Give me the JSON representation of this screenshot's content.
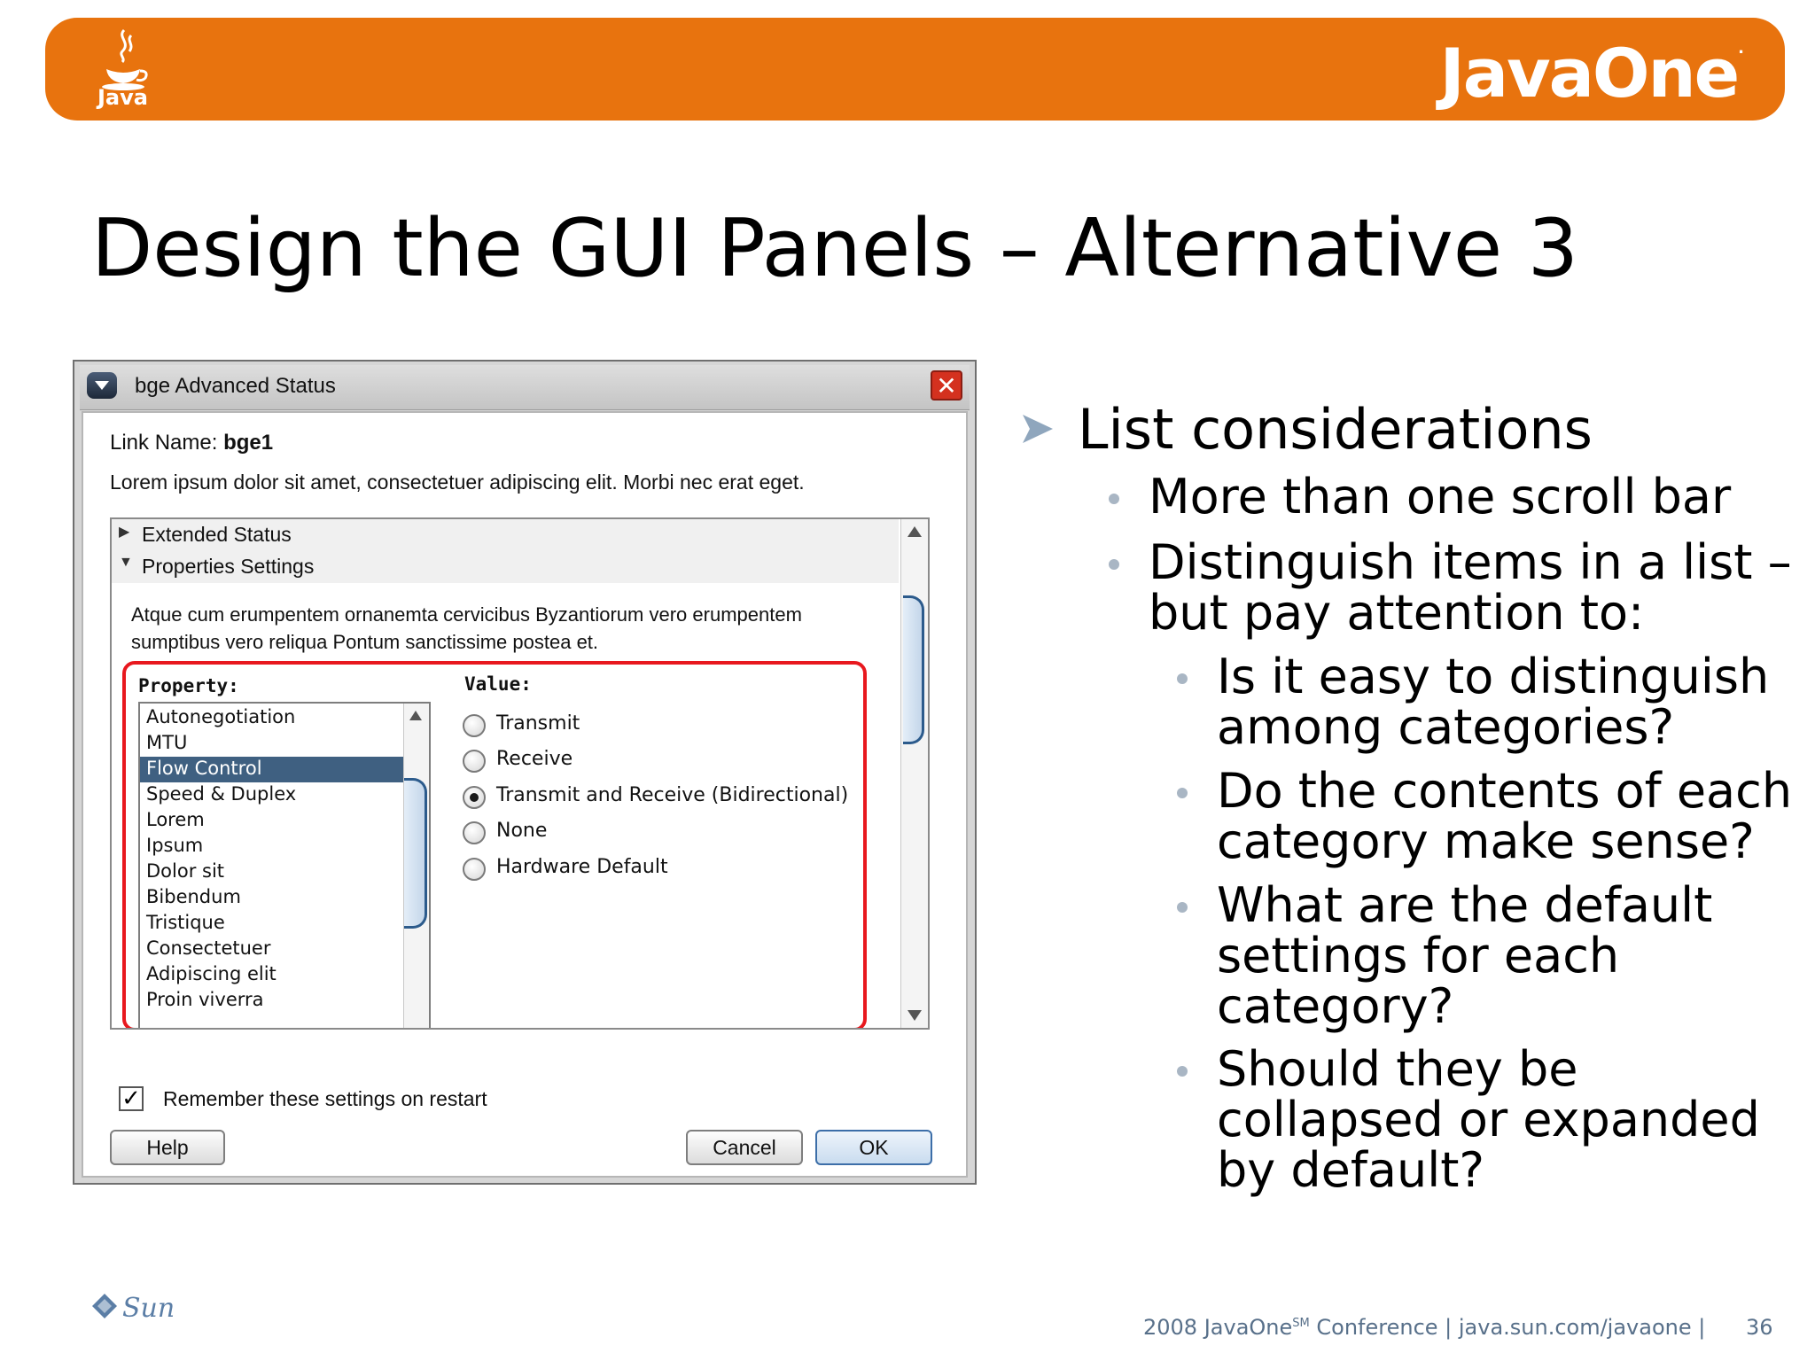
{
  "banner": {
    "java_logo_text": "Java",
    "javaone_logo": "JavaOne",
    "brand_color": "#e8730e"
  },
  "slide": {
    "title": "Design the GUI Panels – Alternative 3"
  },
  "dialog": {
    "title": "bge Advanced Status",
    "close_icon": "close-icon",
    "link_name_label": "Link Name:",
    "link_name_value": "bge1",
    "description": "Lorem ipsum dolor sit amet, consectetuer adipiscing elit. Morbi nec erat eget.",
    "sections": {
      "extended": "Extended Status",
      "properties": "Properties Settings"
    },
    "properties_description_line1": "Atque cum erumpentem ornanemta cervicibus Byzantiorum vero erumpentem",
    "properties_description_line2": "sumptibus vero reliqua Pontum sanctissime postea et.",
    "property_header": "Property:",
    "value_header": "Value:",
    "property_items": [
      "Autonegotiation",
      "MTU",
      "Flow Control",
      "Speed & Duplex",
      "Lorem",
      "Ipsum",
      "Dolor sit",
      "Bibendum",
      "Tristique",
      "Consectetuer",
      "Adipiscing elit",
      "Proin viverra"
    ],
    "selected_property": "Flow Control",
    "value_options": [
      "Transmit",
      "Receive",
      "Transmit and Receive (Bidirectional)",
      "None",
      "Hardware Default"
    ],
    "selected_value": "Transmit and Receive (Bidirectional)",
    "remember_label": "Remember these settings on restart",
    "remember_checked": true,
    "buttons": {
      "help": "Help",
      "cancel": "Cancel",
      "ok": "OK"
    },
    "highlight_color": "#e8181e",
    "selection_color": "#3f6081"
  },
  "bullets": {
    "level1": "List considerations",
    "level2": [
      {
        "lines": [
          "More than one scroll bar"
        ]
      },
      {
        "lines": [
          "Distinguish items in a list –",
          "but pay attention to:"
        ]
      }
    ],
    "level3": [
      {
        "lines": [
          "Is it easy to distinguish",
          "among categories?"
        ]
      },
      {
        "lines": [
          "Do the contents of each",
          "category make sense?"
        ]
      },
      {
        "lines": [
          "What are the default",
          "settings for each",
          "category?"
        ]
      },
      {
        "lines": [
          "Should they be",
          "collapsed or expanded",
          "by default?"
        ]
      }
    ]
  },
  "footer": {
    "sun_logo_text": "Sun",
    "conference_prefix": "2008 JavaOne",
    "conference_sup": "SM",
    "conference_suffix": " Conference |  java.sun.com/javaone  |",
    "page_number": "36"
  }
}
